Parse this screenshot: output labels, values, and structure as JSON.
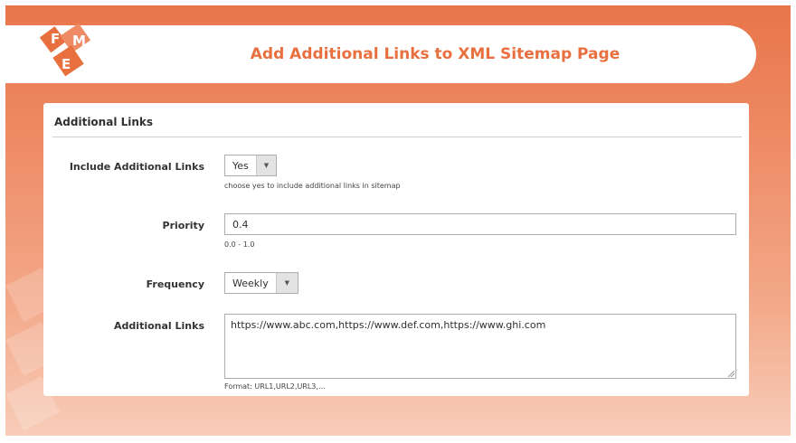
{
  "header": {
    "title": "Add Additional Links to XML Sitemap Page"
  },
  "brand": {
    "accent": "#e8703f",
    "logo_letters": [
      "F",
      "M",
      "E"
    ]
  },
  "panel": {
    "title": "Additional Links",
    "fields": {
      "include": {
        "label": "Include Additional Links",
        "value": "Yes",
        "note": "choose yes to include additional links in sitemap"
      },
      "priority": {
        "label": "Priority",
        "value": "0.4",
        "note": "0.0 - 1.0"
      },
      "frequency": {
        "label": "Frequency",
        "value": "Weekly"
      },
      "links": {
        "label": "Additional Links",
        "value": "https://www.abc.com,https://www.def.com,https://www.ghi.com",
        "note": "Format: URL1,URL2,URL3,..."
      }
    }
  },
  "icons": {
    "dropdown": "chevron-down-icon",
    "resize": "resize-grip-icon"
  }
}
